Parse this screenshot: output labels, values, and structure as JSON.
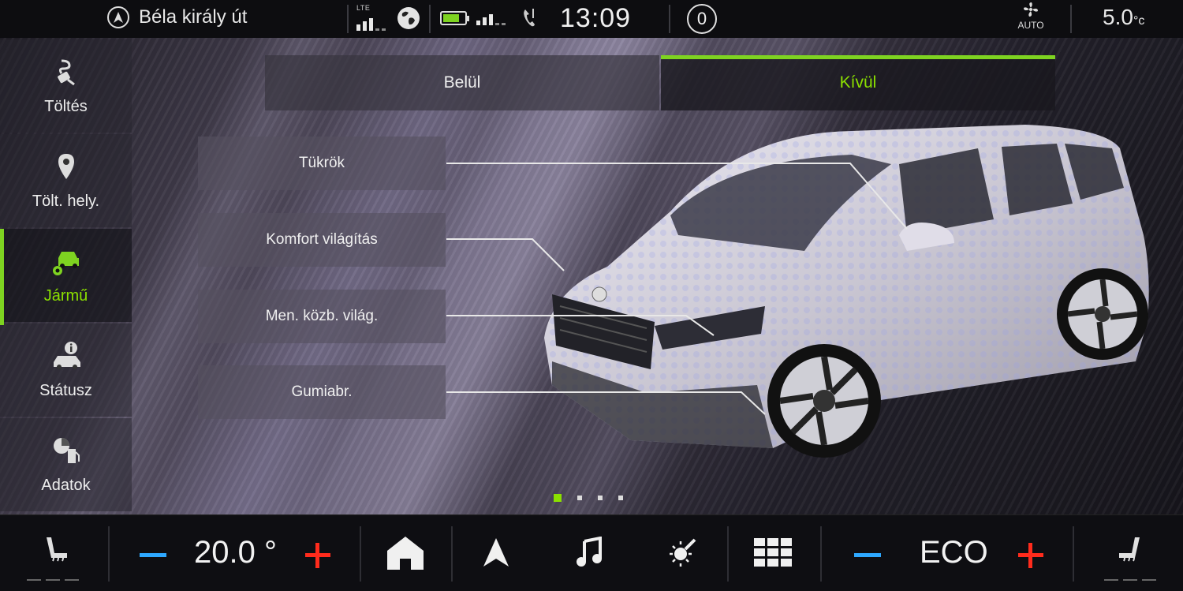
{
  "statusbar": {
    "street": "Béla király út",
    "lte_label": "LTE",
    "time": "13:09",
    "notification_count": "0",
    "fan_label": "AUTO",
    "outside_temp": "5.0",
    "outside_temp_unit": "°c",
    "battery_level": 0.75,
    "icons": [
      "navigation-icon",
      "signal-icon",
      "globe-icon",
      "battery-icon",
      "phone-signal-icon",
      "phone-icon",
      "fan-icon"
    ]
  },
  "sidebar": {
    "items": [
      {
        "label": "Töltés",
        "icon": "charging-plug-icon"
      },
      {
        "label": "Tölt. hely.",
        "icon": "location-pin-icon"
      },
      {
        "label": "Jármű",
        "icon": "car-settings-icon",
        "active": true
      },
      {
        "label": "Státusz",
        "icon": "car-info-icon"
      },
      {
        "label": "Adatok",
        "icon": "fuel-data-icon"
      }
    ]
  },
  "tabs": [
    {
      "label": "Belül",
      "selected": false
    },
    {
      "label": "Kívül",
      "selected": true
    }
  ],
  "options": [
    {
      "label": "Tükrök"
    },
    {
      "label": "Komfort világítás"
    },
    {
      "label": "Men. közb. világ."
    },
    {
      "label": "Gumiabr."
    }
  ],
  "pager": {
    "pages": 4,
    "current": 1
  },
  "bottombar": {
    "cabin_temp": "20.0 °",
    "mode": "ECO",
    "icons": [
      "seat-heat-left-icon",
      "home-icon",
      "navigation-arrow-icon",
      "music-note-icon",
      "light-icon",
      "apps-grid-icon",
      "seat-heat-right-icon"
    ]
  },
  "colors": {
    "accent": "#7ed321",
    "minus": "#2ea8ff",
    "plus": "#ff2b1c"
  }
}
